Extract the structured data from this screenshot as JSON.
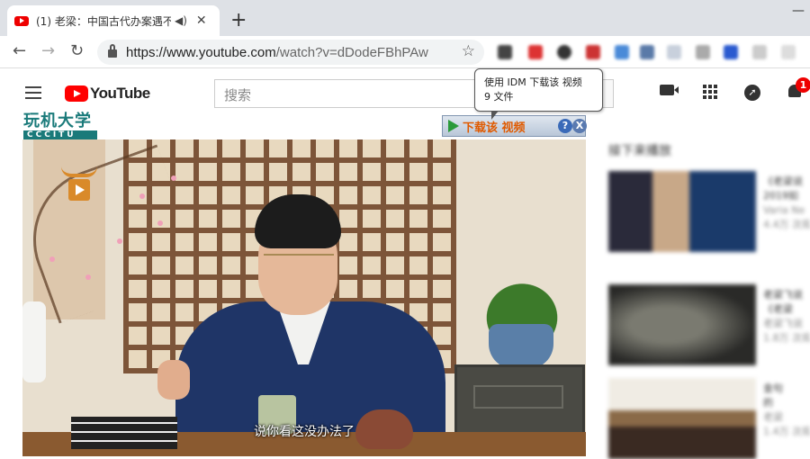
{
  "browser": {
    "tab_title": "(1) 老梁：中国古代办案遇不",
    "audio_icon": "speaker-icon",
    "close_glyph": "✕",
    "new_tab_glyph": "+",
    "url_host": "https://www.youtube.com",
    "url_path": "/watch?v=dDodeFBhPAw"
  },
  "youtube": {
    "logo_text": "YouTube",
    "search_placeholder": "搜索",
    "notification_count": "1",
    "up_next": "接下来播放"
  },
  "watermark": {
    "line1": "玩机大学",
    "line2": "CCCITU"
  },
  "video": {
    "subtitle": "说你看这没办法了"
  },
  "idm": {
    "button_label": "下载该 视频",
    "help": "?",
    "close": "X",
    "tooltip_line1": "使用 IDM 下载该 视频",
    "tooltip_line2": "9  文件"
  },
  "recommendations": [
    {
      "title": "《老梁说",
      "title2": "2019如",
      "channel": "Varia Ne",
      "views": "4.4万 次观看"
    },
    {
      "title": "老梁飞说",
      "title2": "《老梁",
      "channel": "老梁飞说",
      "views": "1.8万 次观看"
    },
    {
      "title": "金句",
      "title2": "的",
      "channel": "老梁",
      "views": "1.4万 次观看"
    }
  ],
  "colors": {
    "youtube_red": "#ff0000",
    "idm_orange": "#e05a00",
    "watermark_teal": "#1a7a7a"
  }
}
